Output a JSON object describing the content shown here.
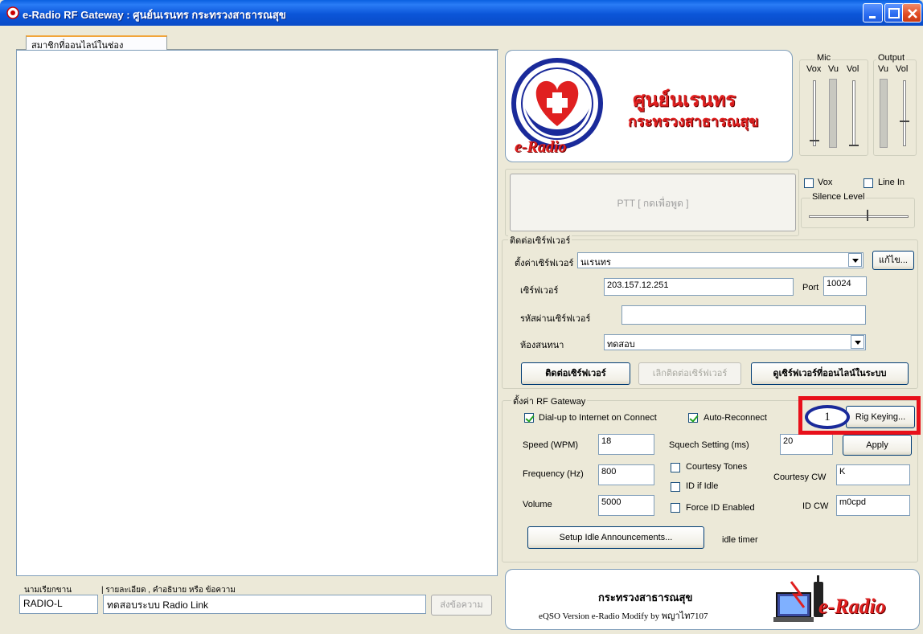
{
  "window": {
    "title": "e-Radio RF Gateway : ศูนย์นเรนทร  กระทรวงสาธารณสุข"
  },
  "chat": {
    "tab_label": "สมาชิกที่ออนไลน์ในช่อง",
    "callsign_header": "นามเรียกขาน",
    "message_header": "| รายละเอียด , คำอธิบาย หรือ ข้อความ",
    "callsign_value": "RADIO-L",
    "message_value": "ทดสอบระบบ Radio Link",
    "send_label": "ส่งข้อความ"
  },
  "logo": {
    "title": "ศูนย์นเรนทร",
    "subtitle": "กระทรวงสาธารณสุข",
    "brand": "e-Radio"
  },
  "mixer": {
    "mic_label": "Mic",
    "output_label": "Output",
    "vox_label": "Vox",
    "vu_label": "Vu",
    "vol_label": "Vol",
    "out_vu_label": "Vu",
    "out_vol_label": "Vol"
  },
  "ptt": {
    "label": "PTT [ กดเพื่อพูด ]",
    "vox_label": "Vox",
    "vox_checked": false,
    "linein_label": "Line In",
    "linein_checked": false,
    "silence_label": "Silence Level"
  },
  "server": {
    "group_label": "ติดต่อเซิร์ฟเวอร์",
    "preset_label": "ตั้งค่าเซิร์ฟเวอร์",
    "preset_value": "นเรนทร",
    "edit_label": "แก้ไข...",
    "server_label": "เซิร์ฟเวอร์",
    "server_value": "203.157.12.251",
    "port_label": "Port",
    "port_value": "10024",
    "password_label": "รหัสผ่านเซิร์ฟเวอร์",
    "password_value": "",
    "room_label": "ห้องสนทนา",
    "room_value": "ทดสอบ",
    "connect_label": "ติดต่อเซิร์ฟเวอร์",
    "disconnect_label": "เลิกติดต่อเซิร์ฟเวอร์",
    "online_label": "ดูเซิร์ฟเวอร์ที่ออนไลน์ในระบบ"
  },
  "gateway": {
    "group_label": "ตั้งค่า RF Gateway",
    "dialup_label": "Dial-up to Internet on Connect",
    "dialup_checked": true,
    "autoreconnect_label": "Auto-Reconnect",
    "autoreconnect_checked": true,
    "rig_keying_label": "Rig Keying...",
    "speed_label": "Speed (WPM)",
    "speed_value": "18",
    "squelch_label": "Squech Setting (ms)",
    "squelch_value": "20",
    "apply_label": "Apply",
    "frequency_label": "Frequency (Hz)",
    "frequency_value": "800",
    "courtesy_tones_label": "Courtesy Tones",
    "courtesy_tones_checked": false,
    "id_if_idle_label": "ID if Idle",
    "id_if_idle_checked": false,
    "courtesy_cw_label": "Courtesy CW",
    "courtesy_cw_value": "K",
    "volume_label": "Volume",
    "volume_value": "5000",
    "force_id_label": "Force ID Enabled",
    "force_id_checked": false,
    "id_cw_label": "ID CW",
    "id_cw_value": "m0cpd",
    "idle_button_label": "Setup Idle Announcements...",
    "idle_timer_label": "idle timer"
  },
  "annotation": {
    "badge_number": "1"
  },
  "footer": {
    "title": "กระทรวงสาธารณสุข",
    "version": "eQSO Version e-Radio  Modify by พญาไท7107",
    "brand": "e-Radio"
  },
  "colors": {
    "titlebar": "#0b55d8",
    "highlight": "#e8101a",
    "brand_red": "#e02020",
    "badge_ring": "#1a2a9a"
  }
}
